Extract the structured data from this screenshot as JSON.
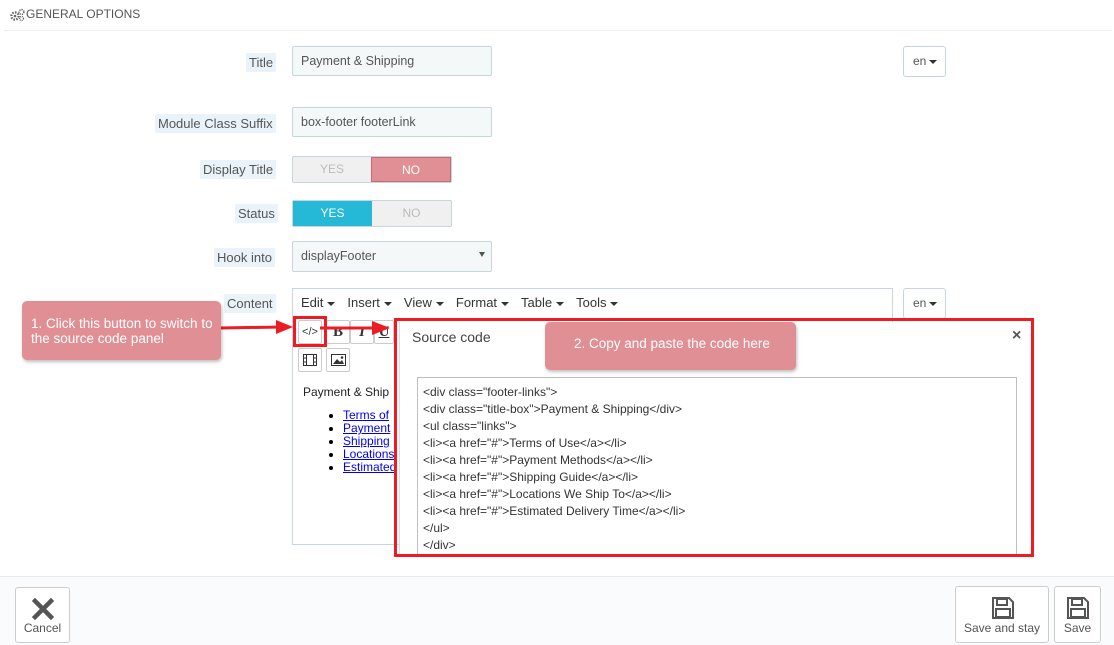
{
  "panel": {
    "heading": "GENERAL OPTIONS"
  },
  "form": {
    "title_label": "Title",
    "title_value": "Payment & Shipping",
    "lang": "en",
    "suffix_label": "Module Class Suffix",
    "suffix_value": "box-footer footerLink",
    "display_title_label": "Display Title",
    "display_title_yes": "YES",
    "display_title_no": "NO",
    "status_label": "Status",
    "status_yes": "YES",
    "status_no": "NO",
    "hook_label": "Hook into",
    "hook_value": "displayFooter",
    "content_label": "Content",
    "content_lang": "en"
  },
  "editor": {
    "menu": [
      "Edit",
      "Insert",
      "View",
      "Format",
      "Table",
      "Tools"
    ],
    "source_btn": "</>",
    "bold_btn": "B",
    "italic_btn": "I",
    "underline_btn": "U",
    "body_title": "Payment & Ship",
    "body_links": [
      "Terms of",
      "Payment",
      "Shipping",
      "Locations",
      "Estimated"
    ]
  },
  "modal": {
    "title": "Source code",
    "close": "×",
    "code_lines": [
      "<div class=\"footer-links\">",
      "<div class=\"title-box\">Payment & Shipping</div>",
      "<ul class=\"links\">",
      "<li><a href=\"#\">Terms of Use</a></li>",
      "<li><a href=\"#\">Payment Methods</a></li>",
      "<li><a href=\"#\">Shipping Guide</a></li>",
      "<li><a href=\"#\">Locations We Ship To</a></li>",
      "<li><a href=\"#\">Estimated Delivery Time</a></li>",
      "</ul>",
      "</div>"
    ]
  },
  "callouts": {
    "step1": "1. Click this button to switch to the source code panel",
    "step2": "2. Copy and paste the code here"
  },
  "footer": {
    "cancel": "Cancel",
    "save_and_stay": "Save and stay",
    "save": "Save"
  },
  "colors": {
    "accent_blue": "#25b9d7",
    "no_pink": "#e08f95",
    "highlight_red": "#ee1b24"
  }
}
